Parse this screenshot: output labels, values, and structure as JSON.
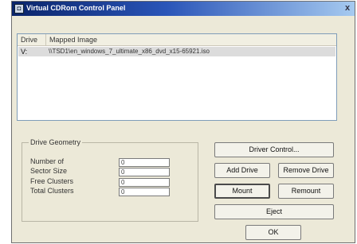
{
  "window": {
    "title": "Virtual CDRom Control Panel",
    "close_glyph": "x"
  },
  "list": {
    "columns": [
      "Drive",
      "Mapped Image"
    ],
    "rows": [
      {
        "drive": "V:",
        "image": "\\\\TSD1\\en_windows_7_ultimate_x86_dvd_x15-65921.iso"
      }
    ]
  },
  "geometry": {
    "title": "Drive Geometry",
    "labels": [
      "Number of",
      "Sector Size",
      "Free Clusters",
      "Total Clusters"
    ],
    "values": [
      "0",
      "0",
      "0",
      "0"
    ]
  },
  "buttons": {
    "driver_control": "Driver Control...",
    "add_drive": "Add Drive",
    "remove_drive": "Remove Drive",
    "mount": "Mount",
    "remount": "Remount",
    "eject": "Eject",
    "ok": "OK"
  },
  "colors": {
    "title_gradient_start": "#0a246a",
    "window_bg": "#ece9d8",
    "selection_row": "#dcdcdc"
  }
}
